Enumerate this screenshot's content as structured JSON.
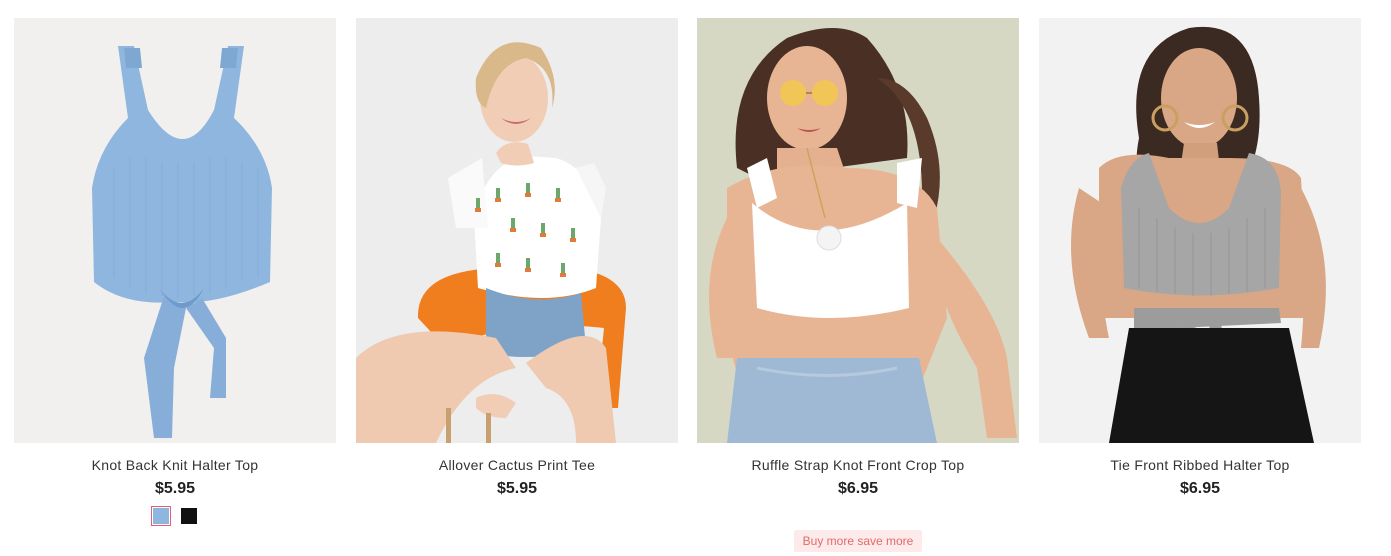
{
  "products": [
    {
      "name": "Knot Back Knit Halter Top",
      "price": "$5.95",
      "image_icon": "blue-knit-halter-top-image",
      "background": "#f1f0ef",
      "swatches": [
        {
          "name": "blue",
          "color": "#8fb6de",
          "selected": true
        },
        {
          "name": "black",
          "color": "#111111",
          "selected": false
        }
      ]
    },
    {
      "name": "Allover Cactus Print Tee",
      "price": "$5.95",
      "image_icon": "model-cactus-tee-image",
      "background": "#eeeded"
    },
    {
      "name": "Ruffle Strap Knot Front Crop Top",
      "price": "$6.95",
      "image_icon": "model-white-crop-top-image",
      "background": "#d6d8c4",
      "promo": "Buy more save more"
    },
    {
      "name": "Tie Front Ribbed Halter Top",
      "price": "$6.95",
      "image_icon": "model-grey-halter-top-image",
      "background": "#f3f2f2"
    }
  ]
}
